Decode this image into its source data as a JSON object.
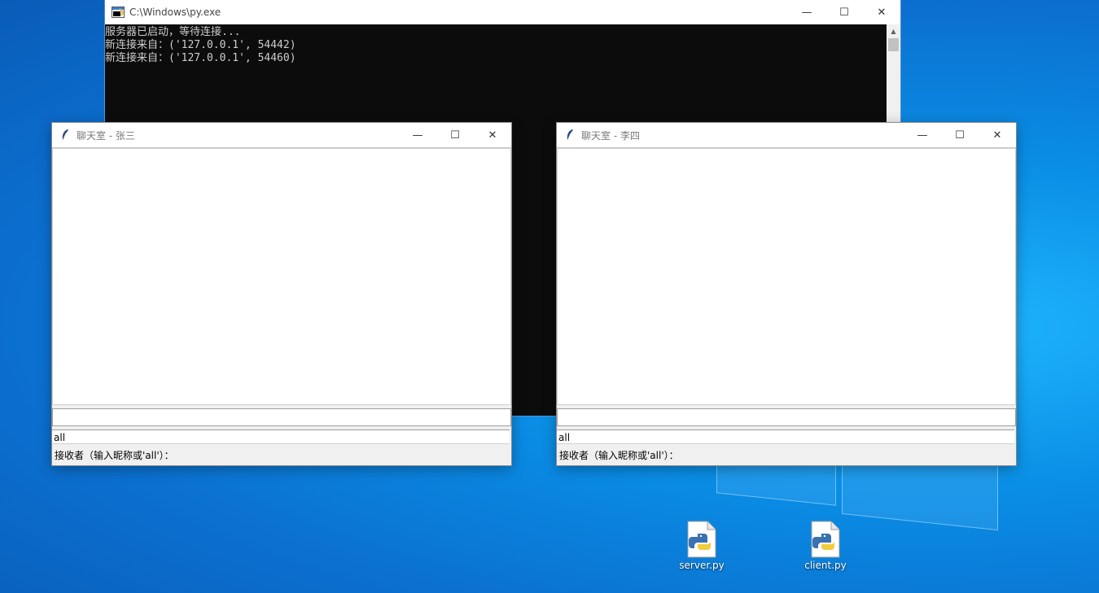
{
  "console": {
    "title": "C:\\Windows\\py.exe",
    "lines": [
      "服务器已启动，等待连接...",
      "新连接来自：('127.0.0.1', 54442)",
      "新连接来自：('127.0.0.1', 54460)"
    ]
  },
  "chat_left": {
    "title": "聊天室 - 张三",
    "message_input_value": "",
    "recipient_value": "all",
    "recipient_label": "接收者（输入昵称或'all'）："
  },
  "chat_right": {
    "title": "聊天室 - 李四",
    "message_input_value": "",
    "recipient_value": "all",
    "recipient_label": "接收者（输入昵称或'all'）："
  },
  "window_controls": {
    "minimize": "—",
    "maximize": "☐",
    "close": "✕"
  },
  "desktop_icons": [
    {
      "name": "server.py",
      "icon": "python-file-icon"
    },
    {
      "name": "client.py",
      "icon": "python-file-icon"
    }
  ],
  "colors": {
    "desktop": "#0a8fe6",
    "console_bg": "#0c0c0c",
    "console_text": "#cccccc"
  }
}
